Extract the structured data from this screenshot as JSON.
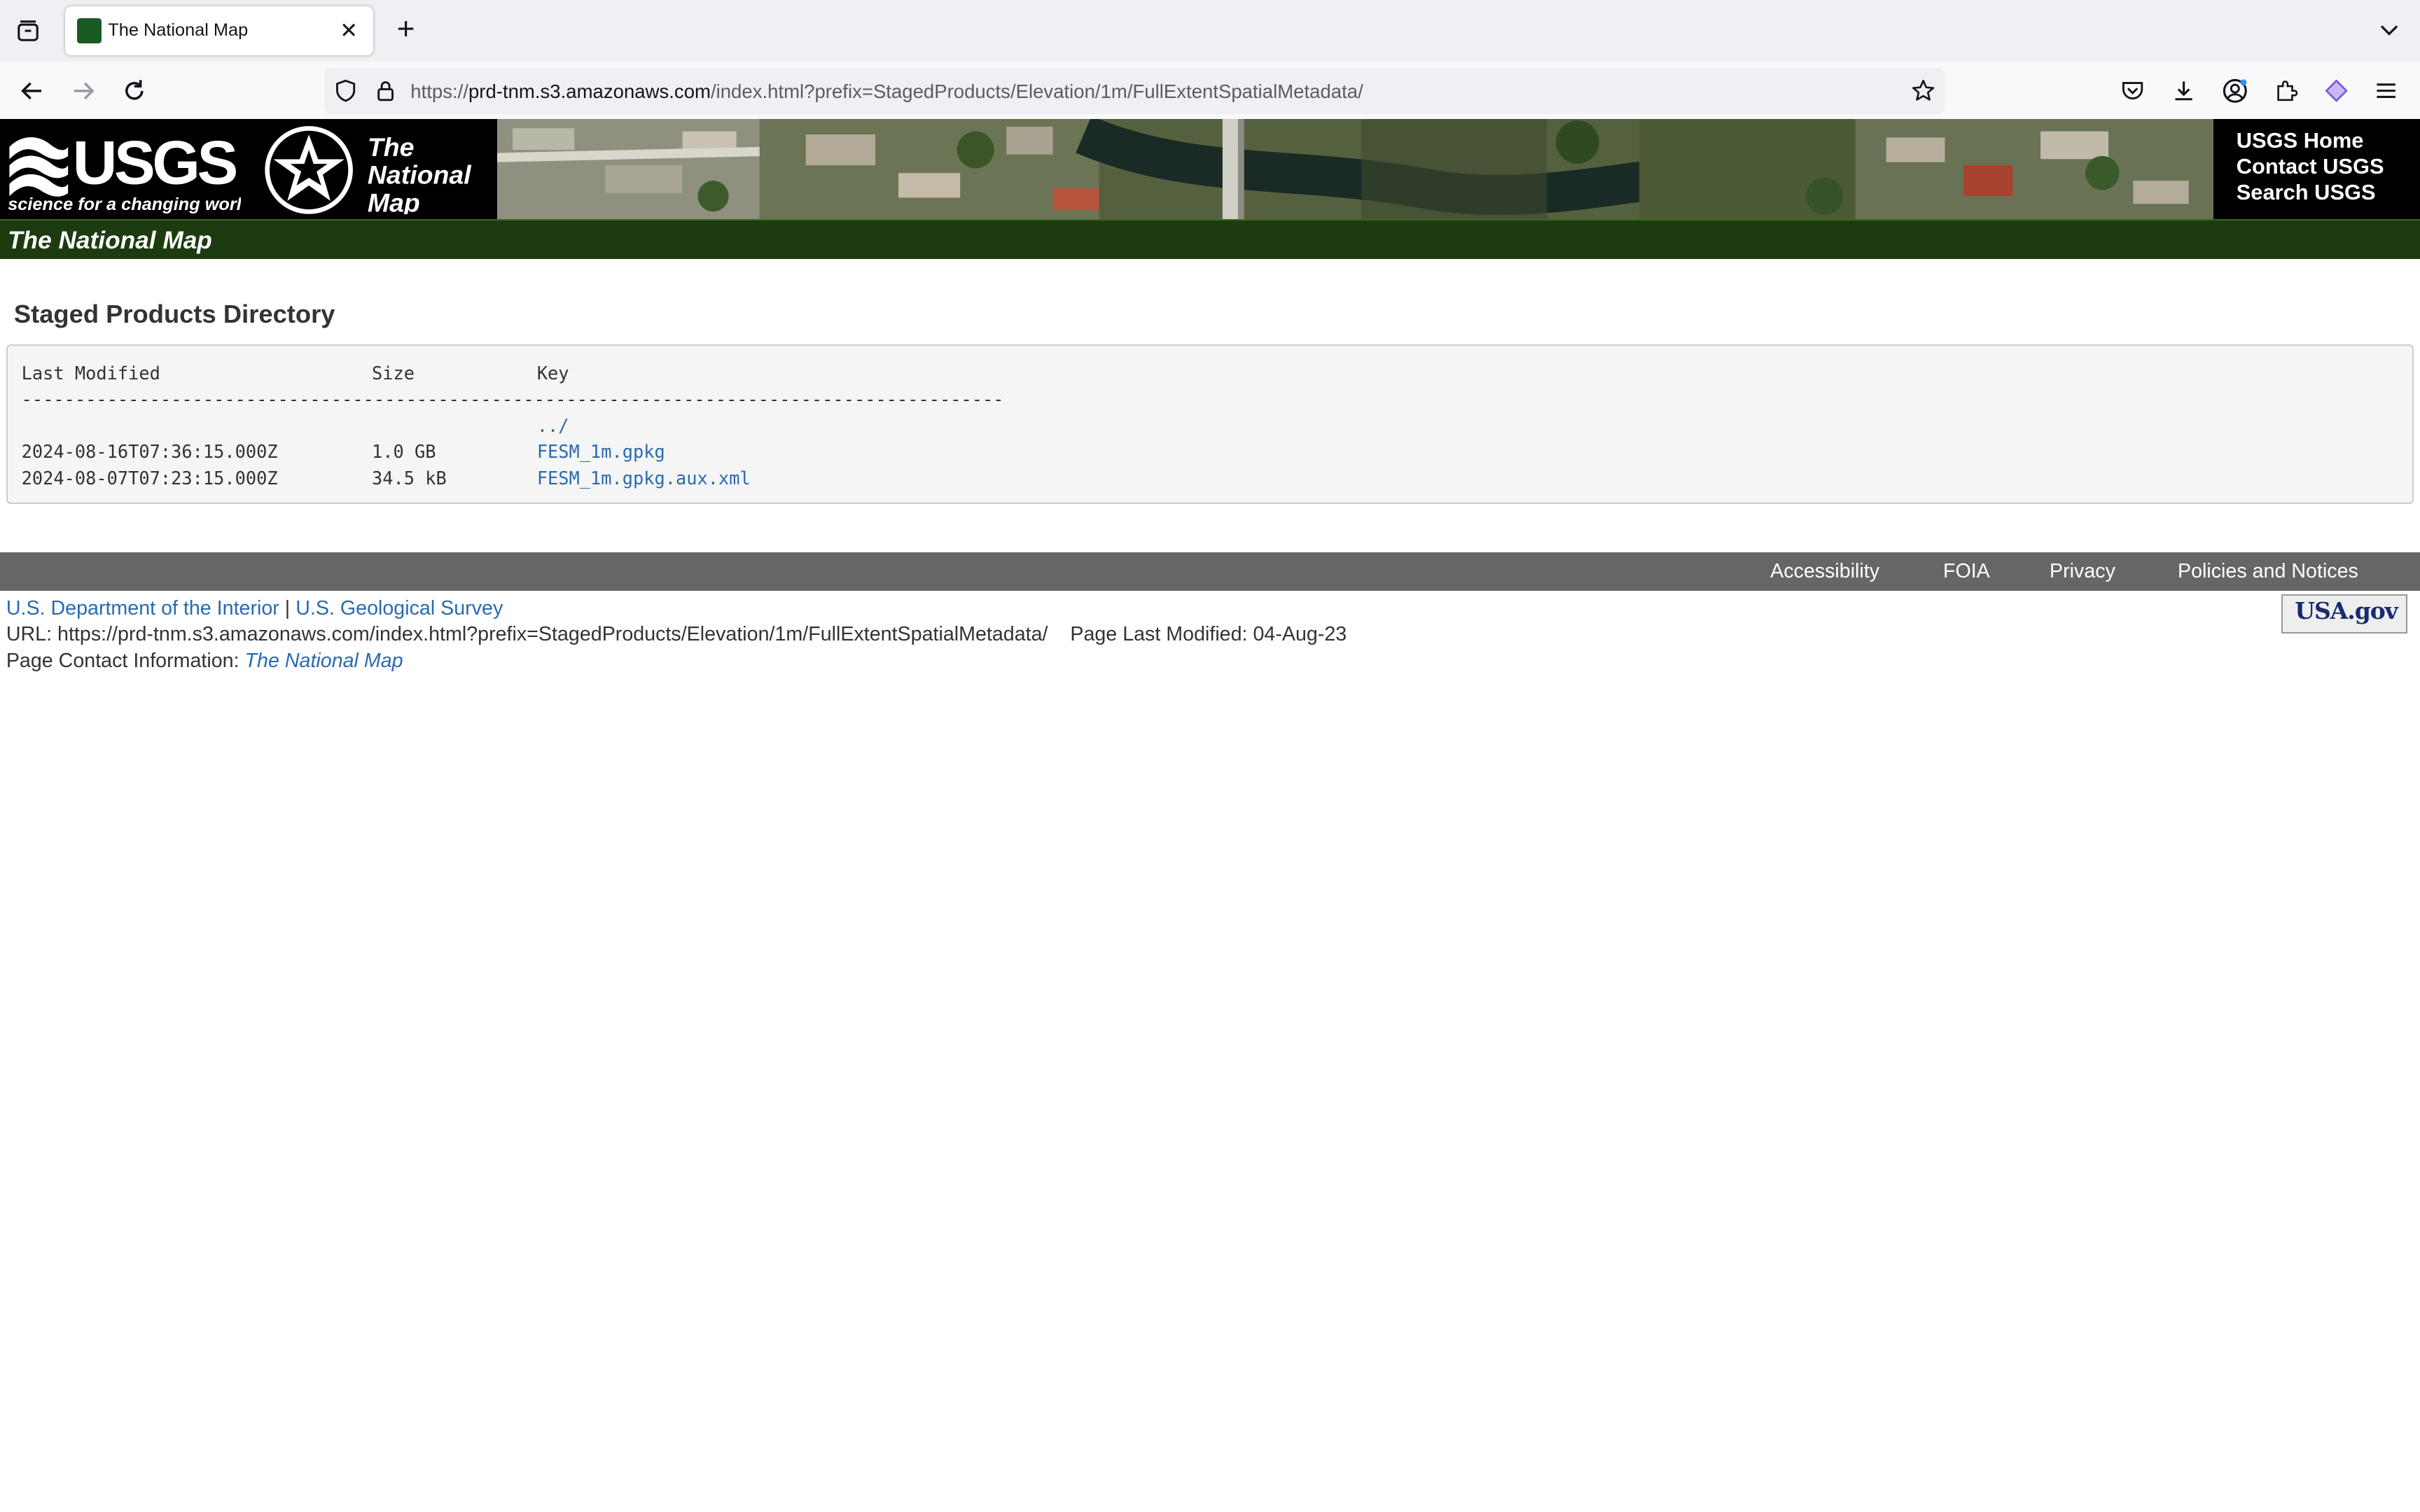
{
  "browser": {
    "tab_title": "The National Map",
    "url_scheme": "https://",
    "url_host": "prd-tnm.s3.amazonaws.com",
    "url_path": "/index.html?prefix=StagedProducts/Elevation/1m/FullExtentSpatialMetadata/"
  },
  "banner": {
    "usgs_logo_text": "USGS",
    "usgs_tagline": "science for a changing world",
    "tnm_logo_text": "The National Map",
    "links": [
      "USGS Home",
      "Contact USGS",
      "Search USGS"
    ]
  },
  "site_bar": {
    "title": "The National Map"
  },
  "directory": {
    "heading": "Staged Products Directory",
    "columns": [
      "Last Modified",
      "Size",
      "Key"
    ],
    "separator": "--------------------------------------------------------------------------------------------",
    "parent_link": "../",
    "rows": [
      {
        "last_modified": "2024-08-16T07:36:15.000Z",
        "size": "1.0 GB",
        "key": "FESM_1m.gpkg"
      },
      {
        "last_modified": "2024-08-07T07:23:15.000Z",
        "size": "34.5 kB",
        "key": "FESM_1m.gpkg.aux.xml"
      }
    ]
  },
  "footer": {
    "links": [
      "Accessibility",
      "FOIA",
      "Privacy",
      "Policies and Notices"
    ],
    "doi_link": "U.S. Department of the Interior",
    "divider": "|",
    "usgs_link": "U.S. Geological Survey",
    "url_label": "URL:",
    "url_value": "https://prd-tnm.s3.amazonaws.com/index.html?prefix=StagedProducts/Elevation/1m/FullExtentSpatialMetadata/",
    "modified_label": "Page Last Modified:",
    "modified_value": "04-Aug-23",
    "contact_label": "Page Contact Information:",
    "contact_link": "The National Map",
    "usagov_text": "USA.gov"
  },
  "icons": {
    "toolbar": [
      "tab-overview-icon",
      "back-icon",
      "forward-icon",
      "reload-icon",
      "shield-icon",
      "lock-icon",
      "bookmark-star-icon",
      "pocket-icon",
      "download-icon",
      "account-icon",
      "extensions-icon",
      "extension-icon",
      "menu-icon",
      "tab-list-icon"
    ]
  },
  "colors": {
    "site_bar_green": "#1d3b10",
    "link_blue": "#2a6ab0",
    "footer_gray": "#666666"
  }
}
